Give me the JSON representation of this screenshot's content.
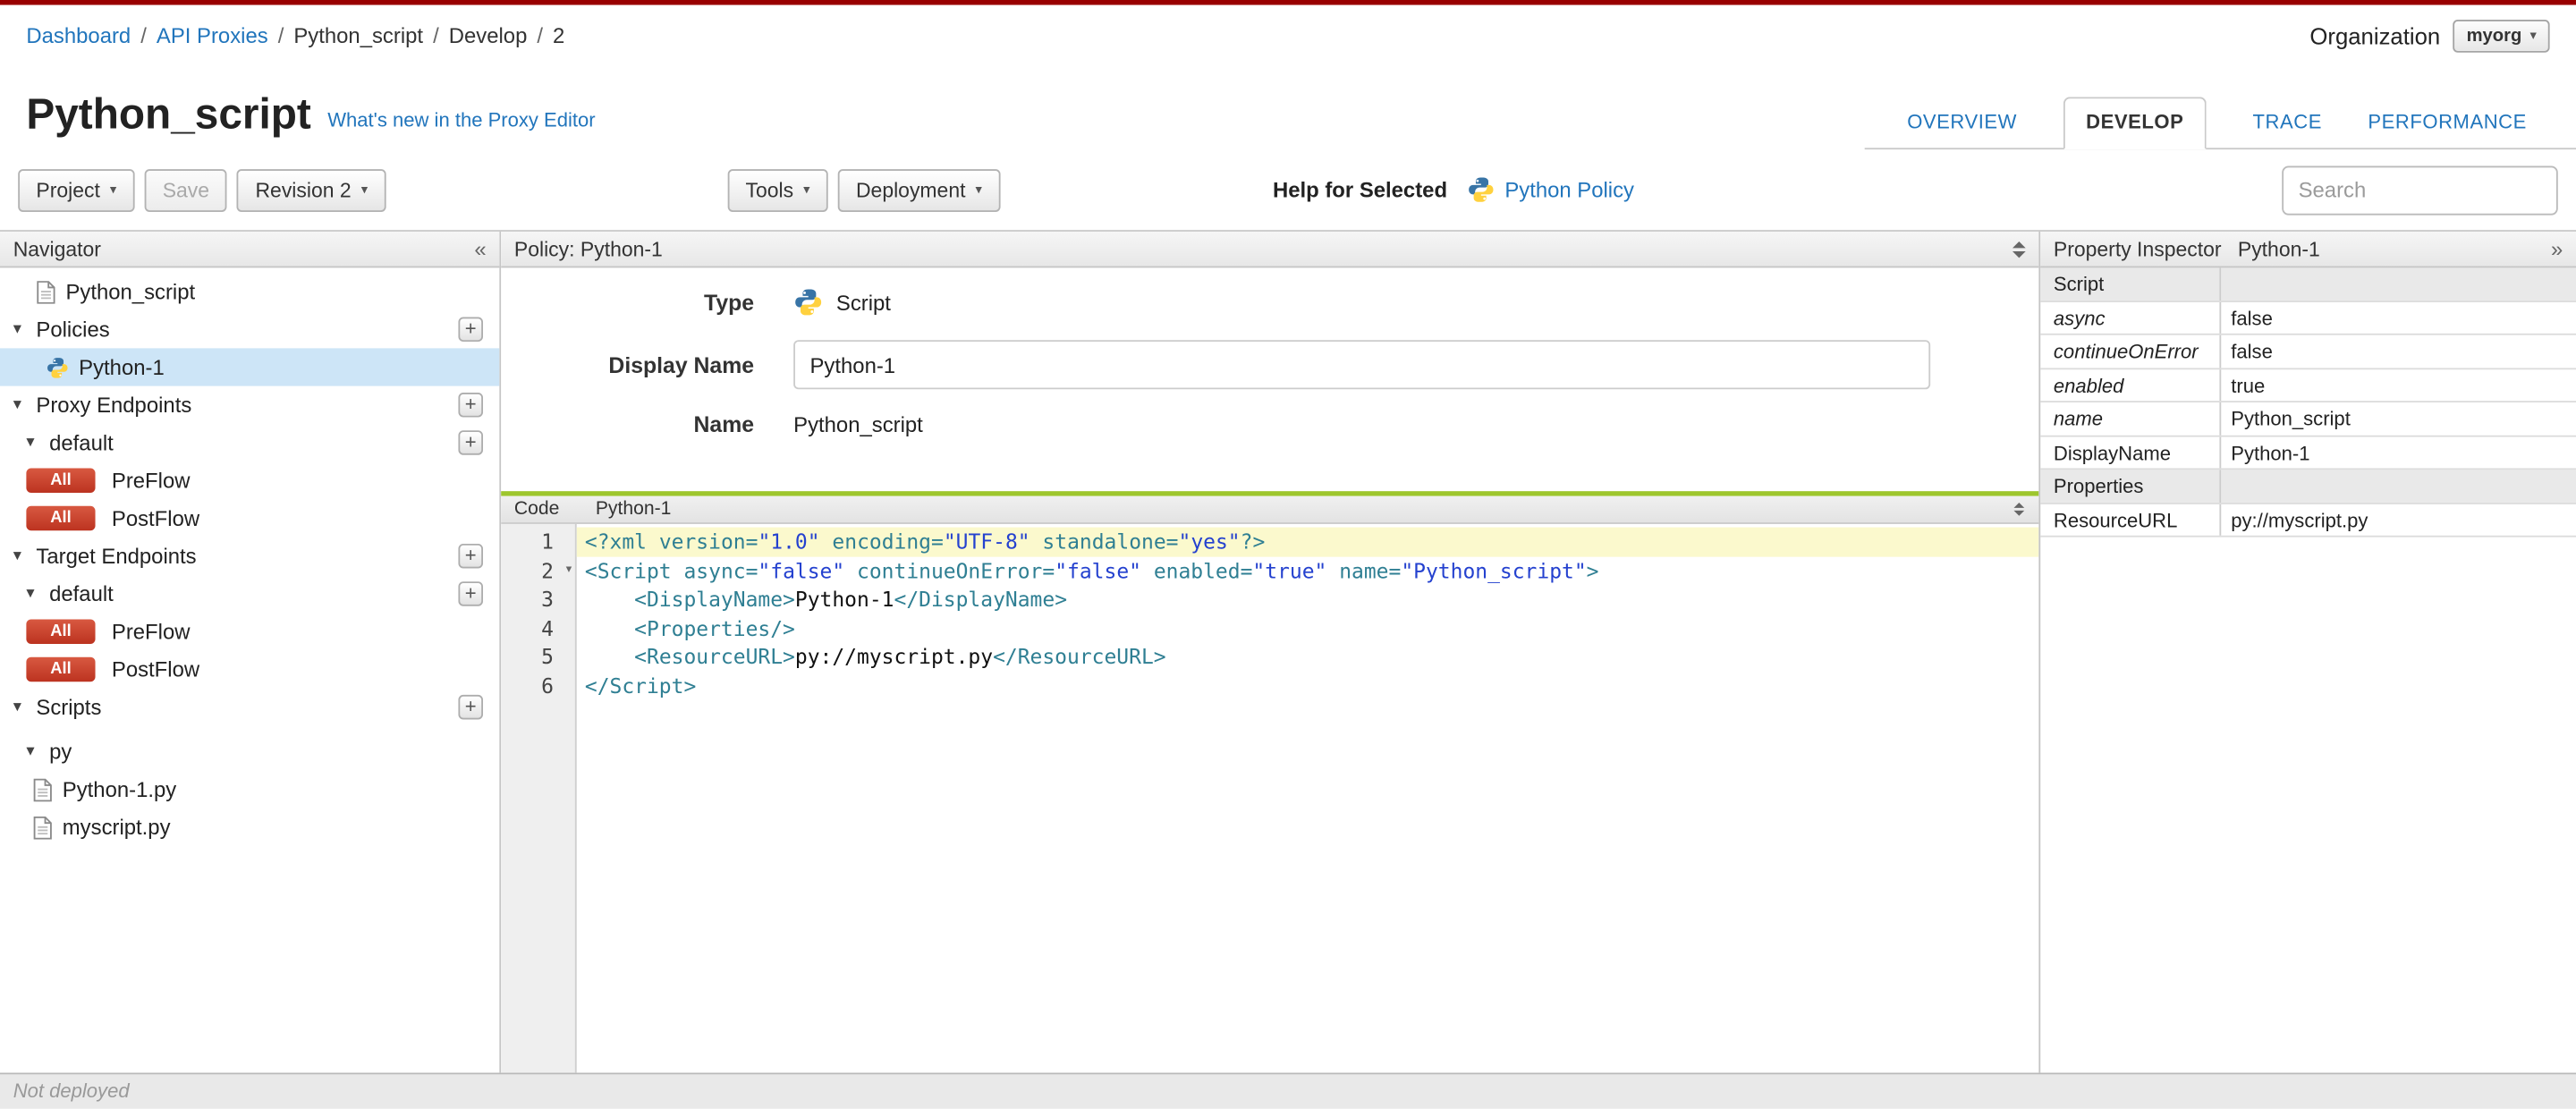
{
  "colors": {
    "top_bar": "#990000",
    "accent_blue": "#2175BC",
    "badge_red": "#C9432F",
    "selection_blue": "#CDE5F7",
    "code_accent_green": "#9DC62D"
  },
  "icons": {
    "caret_down": "▾",
    "button_caret": "▾",
    "collapse_left": "«",
    "collapse_right": "»",
    "plus": "+"
  },
  "breadcrumb": {
    "separator": "/",
    "items": [
      "Dashboard",
      "API Proxies",
      "Python_script",
      "Develop",
      "2"
    ]
  },
  "organization": {
    "label": "Organization",
    "value": "myorg"
  },
  "header": {
    "title": "Python_script",
    "whats_new": "What's new in the Proxy Editor"
  },
  "tabs": {
    "overview": "OVERVIEW",
    "develop": "DEVELOP",
    "trace": "TRACE",
    "performance": "PERFORMANCE"
  },
  "toolbar": {
    "project": "Project",
    "save": "Save",
    "revision": "Revision 2",
    "tools": "Tools",
    "deployment": "Deployment",
    "help_for_selected": "Help for Selected",
    "help_link": "Python Policy",
    "search_placeholder": "Search"
  },
  "navigator": {
    "title": "Navigator",
    "root": "Python_script",
    "policies_section": "Policies",
    "policy": "Python-1",
    "proxy_endpoints_section": "Proxy Endpoints",
    "proxy_default": "default",
    "target_endpoints_section": "Target Endpoints",
    "target_default": "default",
    "scripts_section": "Scripts",
    "flow_badge": "All",
    "preflow": "PreFlow",
    "postflow": "PostFlow",
    "py_folder": "py",
    "files": [
      "Python-1.py",
      "myscript.py"
    ]
  },
  "policy_panel": {
    "header": "Policy: Python-1",
    "type_label": "Type",
    "type_value": "Script",
    "display_name_label": "Display Name",
    "display_name_value": "Python-1",
    "name_label": "Name",
    "name_value": "Python_script"
  },
  "code_panel": {
    "tab": "Code",
    "title": "Python-1",
    "lines": [
      {
        "num": "1",
        "active": true,
        "tokens": [
          [
            "t",
            "<?xml"
          ],
          [
            "p",
            " "
          ],
          [
            "t",
            "version="
          ],
          [
            "s",
            "\"1.0\""
          ],
          [
            "p",
            " "
          ],
          [
            "t",
            "encoding="
          ],
          [
            "s",
            "\"UTF-8\""
          ],
          [
            "p",
            " "
          ],
          [
            "t",
            "standalone="
          ],
          [
            "s",
            "\"yes\""
          ],
          [
            "t",
            "?>"
          ]
        ]
      },
      {
        "num": "2",
        "fold": true,
        "tokens": [
          [
            "t",
            "<Script"
          ],
          [
            "p",
            " "
          ],
          [
            "t",
            "async="
          ],
          [
            "s",
            "\"false\""
          ],
          [
            "p",
            " "
          ],
          [
            "t",
            "continueOnError="
          ],
          [
            "s",
            "\"false\""
          ],
          [
            "p",
            " "
          ],
          [
            "t",
            "enabled="
          ],
          [
            "s",
            "\"true\""
          ],
          [
            "p",
            " "
          ],
          [
            "t",
            "name="
          ],
          [
            "s",
            "\"Python_script\""
          ],
          [
            "t",
            ">"
          ]
        ]
      },
      {
        "num": "3",
        "tokens": [
          [
            "p",
            "    "
          ],
          [
            "t",
            "<DisplayName>"
          ],
          [
            "p",
            "Python-1"
          ],
          [
            "t",
            "</DisplayName>"
          ]
        ]
      },
      {
        "num": "4",
        "tokens": [
          [
            "p",
            "    "
          ],
          [
            "t",
            "<Properties/>"
          ]
        ]
      },
      {
        "num": "5",
        "tokens": [
          [
            "p",
            "    "
          ],
          [
            "t",
            "<ResourceURL>"
          ],
          [
            "p",
            "py://myscript.py"
          ],
          [
            "t",
            "</ResourceURL>"
          ]
        ]
      },
      {
        "num": "6",
        "tokens": [
          [
            "t",
            "</Script>"
          ]
        ]
      }
    ]
  },
  "inspector": {
    "title": "Property Inspector",
    "subtitle": "Python-1",
    "rows": [
      {
        "name": "Script",
        "value": "",
        "type": "section"
      },
      {
        "name": "async",
        "value": "false",
        "type": "attr"
      },
      {
        "name": "continueOnError",
        "value": "false",
        "type": "attr"
      },
      {
        "name": "enabled",
        "value": "true",
        "type": "attr"
      },
      {
        "name": "name",
        "value": "Python_script",
        "type": "attr"
      },
      {
        "name": "DisplayName",
        "value": "Python-1",
        "type": "elem"
      },
      {
        "name": "Properties",
        "value": "",
        "type": "sub"
      },
      {
        "name": "ResourceURL",
        "value": "py://myscript.py",
        "type": "elem"
      }
    ]
  },
  "statusbar": {
    "text": "Not deployed"
  }
}
